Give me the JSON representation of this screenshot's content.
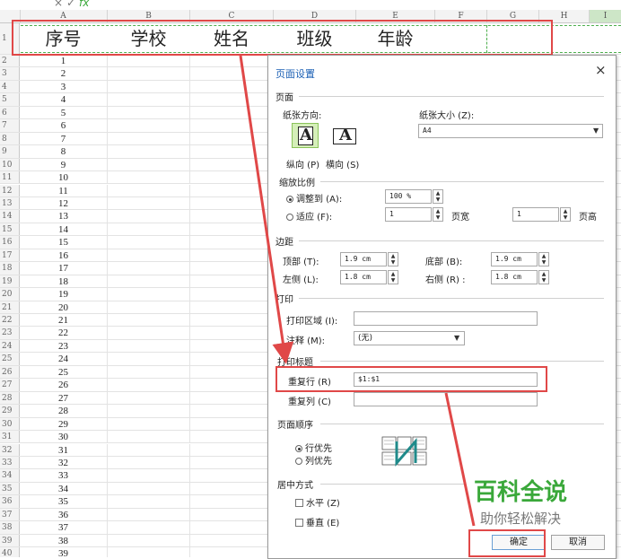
{
  "formula_bar": {
    "cancel_symbol": "×",
    "confirm_symbol": "✓",
    "fx_symbol": "fx"
  },
  "columns": [
    "A",
    "B",
    "C",
    "D",
    "E",
    "F",
    "G",
    "H",
    "I"
  ],
  "header_row": {
    "row_number": "1",
    "cells": [
      "序号",
      "学校",
      "姓名",
      "班级",
      "年龄"
    ]
  },
  "rows": [
    {
      "num": "2",
      "val": "1"
    },
    {
      "num": "3",
      "val": "2"
    },
    {
      "num": "4",
      "val": "3"
    },
    {
      "num": "5",
      "val": "4"
    },
    {
      "num": "6",
      "val": "5"
    },
    {
      "num": "7",
      "val": "6"
    },
    {
      "num": "8",
      "val": "7"
    },
    {
      "num": "9",
      "val": "8"
    },
    {
      "num": "10",
      "val": "9"
    },
    {
      "num": "11",
      "val": "10"
    },
    {
      "num": "12",
      "val": "11"
    },
    {
      "num": "13",
      "val": "12"
    },
    {
      "num": "14",
      "val": "13"
    },
    {
      "num": "15",
      "val": "14"
    },
    {
      "num": "16",
      "val": "15"
    },
    {
      "num": "17",
      "val": "16"
    },
    {
      "num": "18",
      "val": "17"
    },
    {
      "num": "19",
      "val": "18"
    },
    {
      "num": "20",
      "val": "19"
    },
    {
      "num": "21",
      "val": "20"
    },
    {
      "num": "22",
      "val": "21"
    },
    {
      "num": "23",
      "val": "22"
    },
    {
      "num": "24",
      "val": "23"
    },
    {
      "num": "25",
      "val": "24"
    },
    {
      "num": "26",
      "val": "25"
    },
    {
      "num": "27",
      "val": "26"
    },
    {
      "num": "28",
      "val": "27"
    },
    {
      "num": "29",
      "val": "28"
    },
    {
      "num": "30",
      "val": "29"
    },
    {
      "num": "31",
      "val": "30"
    },
    {
      "num": "32",
      "val": "31"
    },
    {
      "num": "33",
      "val": "32"
    },
    {
      "num": "34",
      "val": "33"
    },
    {
      "num": "35",
      "val": "34"
    },
    {
      "num": "36",
      "val": "35"
    },
    {
      "num": "37",
      "val": "36"
    },
    {
      "num": "38",
      "val": "37"
    },
    {
      "num": "39",
      "val": "38"
    },
    {
      "num": "40",
      "val": "39"
    }
  ],
  "dialog": {
    "title": "页面设置",
    "close": "×",
    "page_section": "页面",
    "orientation_label": "纸张方向:",
    "portrait_glyph": "A",
    "landscape_glyph": "A",
    "portrait_label": "纵向 (P)",
    "landscape_label": "横向 (S)",
    "paper_size_label": "纸张大小 (Z):",
    "paper_size_value": "A4",
    "scale_section": "缩放比例",
    "adjust_to_label": "调整到 (A):",
    "adjust_to_value": "100 %",
    "fit_to_label": "适应 (F):",
    "fit_width_value": "1",
    "fit_width_label": "页宽",
    "fit_height_value": "1",
    "fit_height_label": "页高",
    "margins_section": "边距",
    "top_label": "顶部 (T):",
    "top_value": "1.9 cm",
    "bottom_label": "底部 (B):",
    "bottom_value": "1.9 cm",
    "left_label": "左侧 (L):",
    "left_value": "1.8 cm",
    "right_label": "右侧 (R) :",
    "right_value": "1.8 cm",
    "print_section": "打印",
    "print_area_label": "打印区域 (I):",
    "print_area_value": "",
    "comments_label": "注释 (M):",
    "comments_value": "(无)",
    "print_titles_section": "打印标题",
    "repeat_rows_label": "重复行 (R)",
    "repeat_rows_value": "$1:$1",
    "repeat_cols_label": "重复列 (C)",
    "repeat_cols_value": "",
    "page_order_section": "页面顺序",
    "rows_first_label": "行优先",
    "cols_first_label": "列优先",
    "center_section": "居中方式",
    "horizontal_label": "水平 (Z)",
    "vertical_label": "垂直 (E)",
    "ok_label": "确定",
    "cancel_label": "取消"
  },
  "watermark": {
    "title": "百科全说",
    "subtitle": "助你轻松解决"
  },
  "colors": {
    "highlight": "#e04848",
    "watermark_green": "#3aa83a",
    "title_blue": "#1a5fb4"
  }
}
